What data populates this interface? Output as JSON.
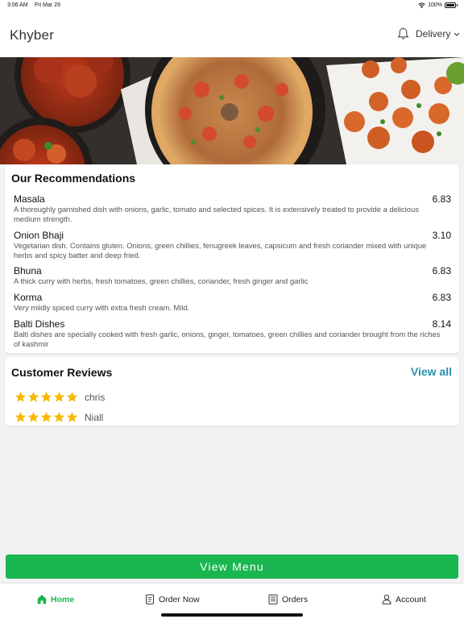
{
  "status_bar": {
    "time": "3:06 AM",
    "date": "Fri Mar 29",
    "battery": "100%"
  },
  "header": {
    "title": "Khyber",
    "delivery_label": "Delivery"
  },
  "recommendations": {
    "title": "Our Recommendations",
    "items": [
      {
        "name": "Masala",
        "price": "6.83",
        "description": "A thoroughly garnished dish with onions, garlic, tomato and selected spices. It is extensively treated to provide a delicious medium strength."
      },
      {
        "name": "Onion Bhaji",
        "price": "3.10",
        "description": "Vegetarian dish. Contains gluten. Onions, green chillies, fenugreek leaves, capsicum and fresh coriander mixed with unique herbs and spicy batter and deep fried."
      },
      {
        "name": "Bhuna",
        "price": "6.83",
        "description": "A thick curry with herbs, fresh tomatoes, green chillies, coriander, fresh ginger and garlic"
      },
      {
        "name": "Korma",
        "price": "6.83",
        "description": "Very mildly spiced curry with extra fresh cream. Mild."
      },
      {
        "name": "Balti Dishes",
        "price": "8.14",
        "description": "Balti dishes are specially cooked with fresh garlic, onions, ginger, tomatoes, green chillies and coriander brought from the riches of kashmir"
      }
    ]
  },
  "reviews": {
    "title": "Customer Reviews",
    "view_all": "View all",
    "items": [
      {
        "name": "chris",
        "stars": 5
      },
      {
        "name": "Niall",
        "stars": 5
      }
    ]
  },
  "view_menu_label": "View Menu",
  "tabs": [
    {
      "label": "Home",
      "icon": "home-icon",
      "active": true
    },
    {
      "label": "Order Now",
      "icon": "order-icon",
      "active": false
    },
    {
      "label": "Orders",
      "icon": "receipt-icon",
      "active": false
    },
    {
      "label": "Account",
      "icon": "user-icon",
      "active": false
    }
  ],
  "colors": {
    "accent_green": "#1ab650",
    "link_blue": "#2b8fb0",
    "star_yellow": "#f5b800"
  }
}
